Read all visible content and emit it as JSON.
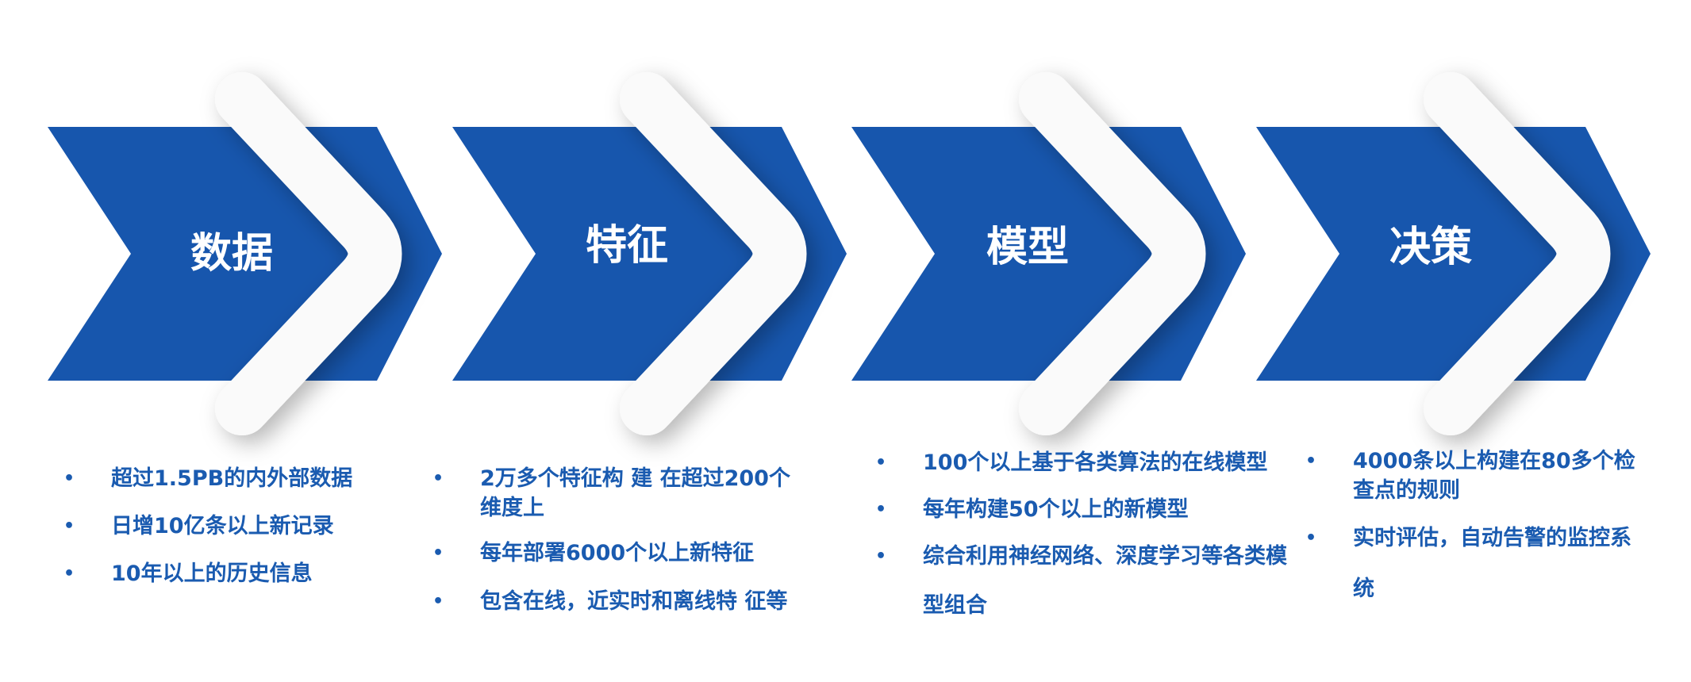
{
  "colors": {
    "chevron_blue": "#1756ad",
    "text_blue": "#1a5bb0",
    "arc_white": "#fafafa"
  },
  "stages": [
    {
      "title": "数据",
      "bullets": [
        "超过1.5PB的内外部数据",
        "日增10亿条以上新记录",
        "10年以上的历史信息"
      ]
    },
    {
      "title": "特征",
      "bullets": [
        "2万多个特征构 建 在超过200个维度上",
        "每年部署6000个以上新特征",
        "包含在线，近实时和离线特  征等"
      ]
    },
    {
      "title": "模型",
      "bullets": [
        "100个以上基于各类算法的在线模型",
        "每年构建50个以上的新模型",
        "综合利用神经网络、深度学习等各类模型组合"
      ]
    },
    {
      "title": "决策",
      "bullets": [
        "4000条以上构建在80多个检查点的规则",
        "实时评估，自动告警的监控系统"
      ]
    }
  ]
}
